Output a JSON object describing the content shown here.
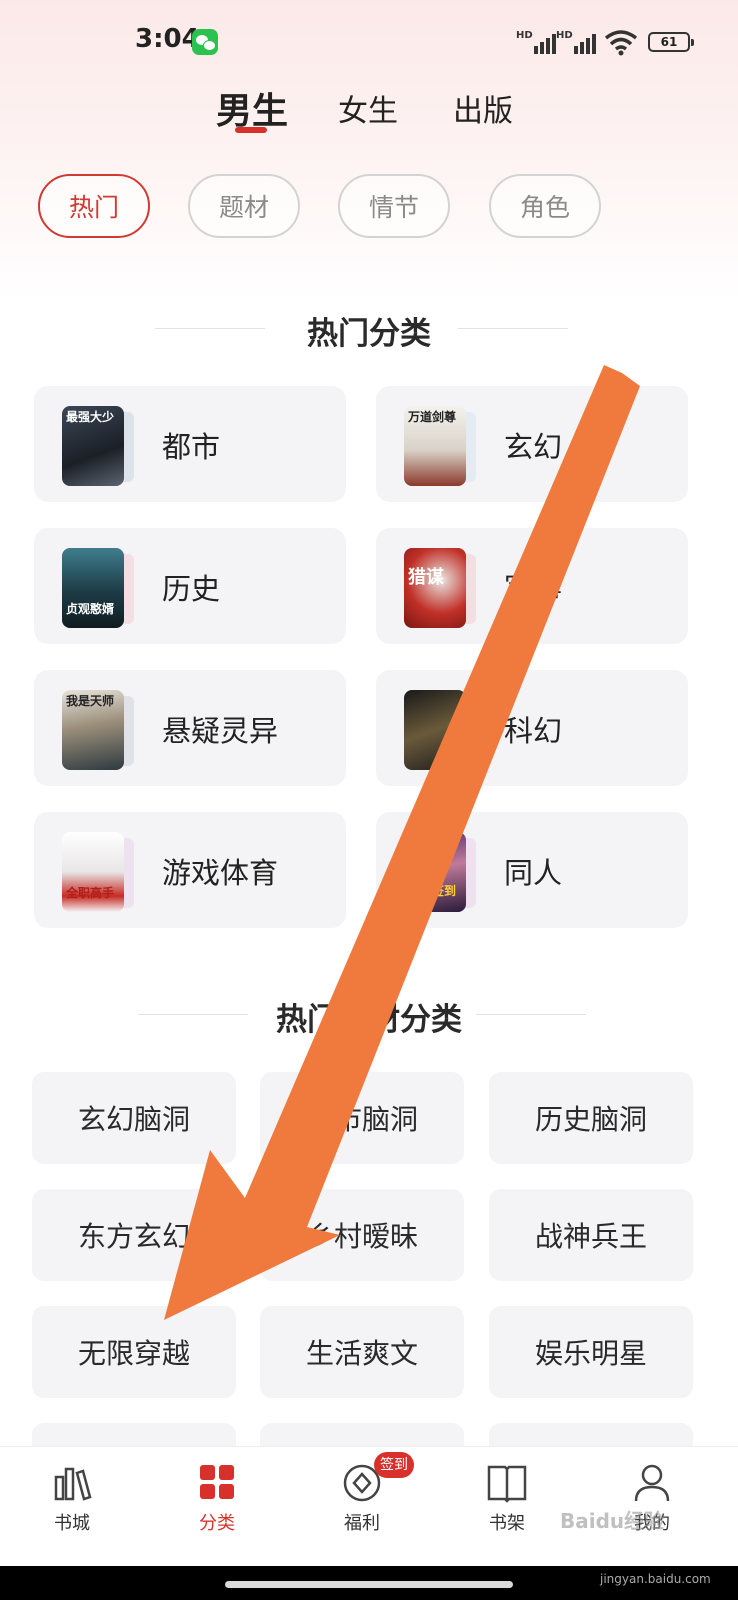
{
  "status_bar": {
    "time": "3:04",
    "signal1": "HD",
    "signal2": "HD",
    "battery": "61"
  },
  "gender_tabs": [
    {
      "label": "男生",
      "active": true
    },
    {
      "label": "女生",
      "active": false
    },
    {
      "label": "出版",
      "active": false
    }
  ],
  "chips": [
    {
      "label": "热门",
      "active": true
    },
    {
      "label": "题材",
      "active": false
    },
    {
      "label": "情节",
      "active": false
    },
    {
      "label": "角色",
      "active": false
    }
  ],
  "hot_section": {
    "title": "热门分类",
    "items": [
      {
        "label": "都市",
        "cover_text": "最强大少"
      },
      {
        "label": "玄幻",
        "cover_text": "万道剑尊"
      },
      {
        "label": "历史",
        "cover_text": "贞观憨婿"
      },
      {
        "label": "军事",
        "cover_text": "猎谋"
      },
      {
        "label": "悬疑灵异",
        "cover_text": "我是天师"
      },
      {
        "label": "科幻",
        "cover_text": ""
      },
      {
        "label": "游戏体育",
        "cover_text": "全职高手"
      },
      {
        "label": "同人",
        "cover_text": "开局签到"
      }
    ]
  },
  "theme_section": {
    "title": "热门题材分类",
    "items": [
      "玄幻脑洞",
      "都市脑洞",
      "历史脑洞",
      "东方玄幻",
      "乡村暧昧",
      "战神兵王",
      "无限穿越",
      "生活爽文",
      "娱乐明星"
    ]
  },
  "bottom_nav": [
    {
      "label": "书城",
      "icon": "bookstore-icon",
      "active": false
    },
    {
      "label": "分类",
      "icon": "category-grid-icon",
      "active": true
    },
    {
      "label": "福利",
      "icon": "coin-icon",
      "active": false
    },
    {
      "label": "书架",
      "icon": "bookshelf-icon",
      "active": false
    },
    {
      "label": "我的",
      "icon": "user-icon",
      "active": false
    }
  ],
  "checkin_badge": "签到",
  "watermark": {
    "logo": "Baidu经验",
    "url": "jingyan.baidu.com"
  },
  "colors": {
    "accent": "#d8312c",
    "card_bg": "#f4f4f6",
    "arrow": "#f07a3e"
  }
}
